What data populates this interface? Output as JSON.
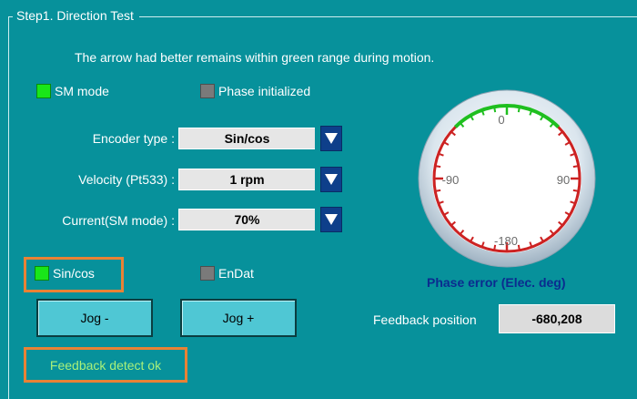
{
  "group": {
    "title": "Step1. Direction Test"
  },
  "instruction": "The arrow had better remains within green range during motion.",
  "indicators": {
    "sm_mode": {
      "label": "SM mode",
      "state": "on"
    },
    "phase_initialized": {
      "label": "Phase initialized",
      "state": "off"
    },
    "sincos": {
      "label": "Sin/cos",
      "state": "on"
    },
    "endat": {
      "label": "EnDat",
      "state": "off"
    }
  },
  "fields": {
    "encoder_type": {
      "label": "Encoder type :",
      "value": "Sin/cos"
    },
    "velocity": {
      "label": "Velocity (Pt533) :",
      "value": "1 rpm"
    },
    "current": {
      "label": "Current(SM mode) :",
      "value": "70%"
    }
  },
  "buttons": {
    "jog_minus": "Jog -",
    "jog_plus": "Jog +"
  },
  "gauge": {
    "labels": {
      "top": "0",
      "left": "-90",
      "right": "90",
      "bottom": "-180"
    },
    "caption": "Phase error (Elec. deg)",
    "green_range_deg": [
      -45,
      45
    ]
  },
  "feedback": {
    "label": "Feedback position",
    "value": "-680,208"
  },
  "status": "Feedback detect ok",
  "colors": {
    "background": "#07919b",
    "led_on": "#19e619",
    "led_off": "#7a7a7a",
    "highlight": "#e98235",
    "gauge_red": "#cc2222",
    "gauge_green": "#1fbf1f",
    "caption": "#0b2b8f"
  }
}
